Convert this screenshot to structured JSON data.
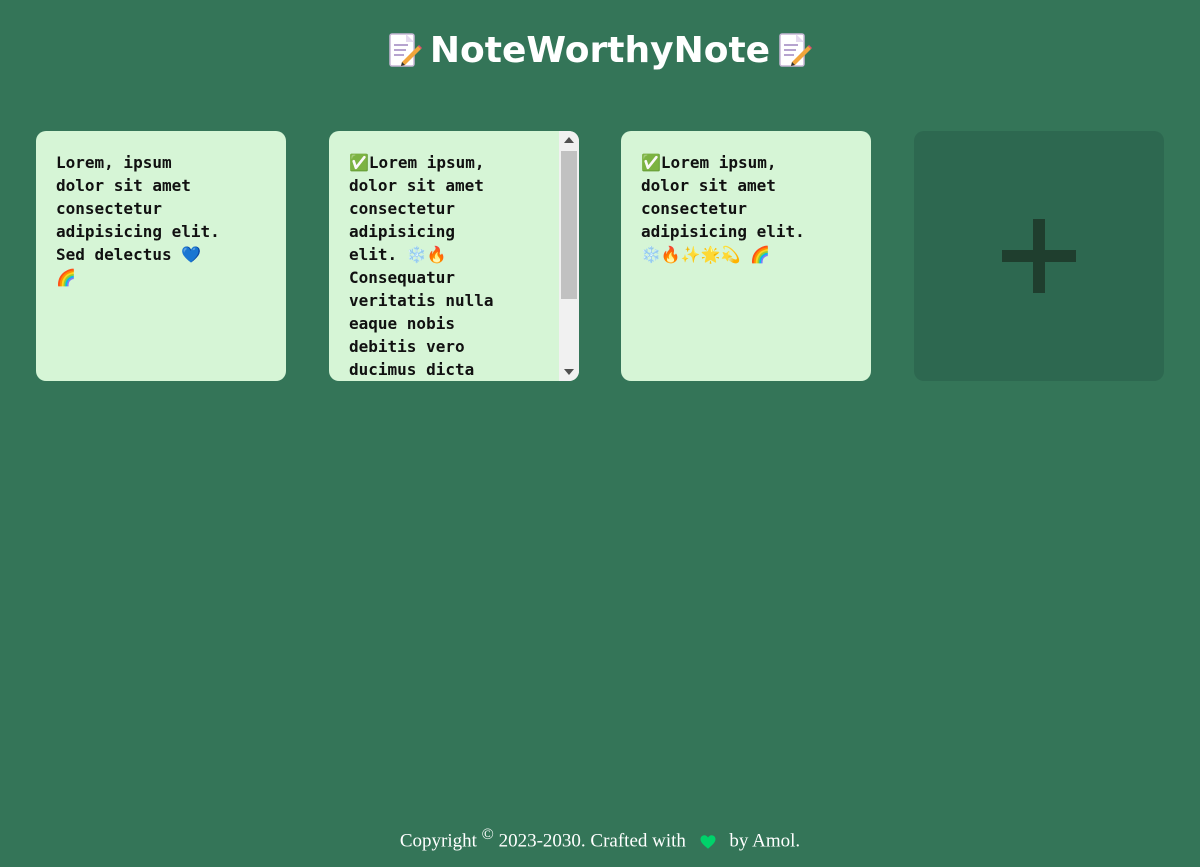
{
  "header": {
    "title": "NoteWorthyNote",
    "left_icon": "memo-icon",
    "right_icon": "memo-icon"
  },
  "notes": [
    {
      "text": "Lorem, ipsum\ndolor sit amet\nconsectetur\nadipisicing elit.\nSed delectus 💙\n🌈"
    },
    {
      "text": "✅Lorem ipsum,\ndolor sit amet\nconsectetur\nadipisicing\nelit. ❄️🔥\nConsequatur\nveritatis nulla\neaque nobis\ndebitis vero\nducimus dicta"
    },
    {
      "text": "✅Lorem ipsum,\ndolor sit amet\nconsectetur\nadipisicing elit.\n❄️🔥✨🌟💫 🌈"
    }
  ],
  "add_note": {
    "icon": "plus-icon"
  },
  "footer": {
    "prefix": "Copyright",
    "symbol": "©",
    "suffix": "2023-2030. Crafted with",
    "heart_icon": "green-heart-icon",
    "author": "by Amol."
  },
  "colors": {
    "background": "#347558",
    "note_background": "#d6f5d6",
    "add_note_background": "#2d6850",
    "plus_color": "#1f3e2e"
  }
}
